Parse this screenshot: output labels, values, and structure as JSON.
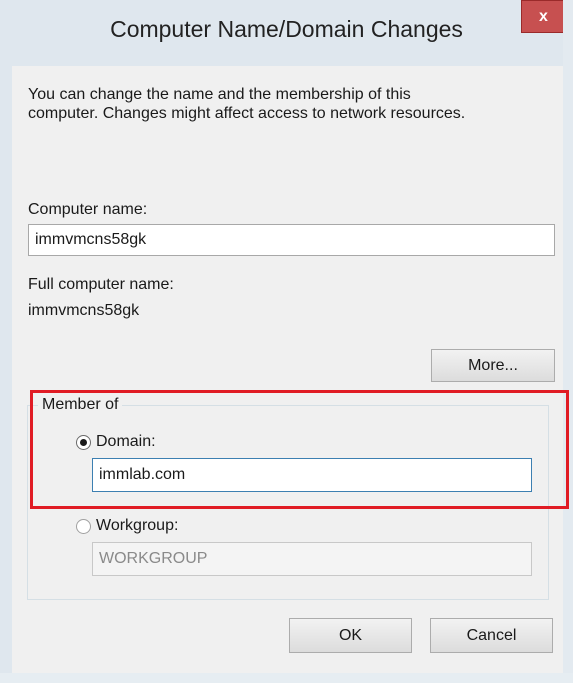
{
  "window": {
    "title": "Computer Name/Domain Changes",
    "close_label": "x"
  },
  "description": {
    "line1": "You can change the name and the membership of this",
    "line2": "computer. Changes might affect access to network resources."
  },
  "computer_name": {
    "label": "Computer name:",
    "value": "immvmcns58gk"
  },
  "full_name": {
    "label": "Full computer name:",
    "value": "immvmcns58gk"
  },
  "more_button": "More...",
  "member_of": {
    "label": "Member of",
    "domain": {
      "label": "Domain:",
      "selected": true,
      "value": "immlab.com"
    },
    "workgroup": {
      "label": "Workgroup:",
      "selected": false,
      "value": "WORKGROUP"
    }
  },
  "buttons": {
    "ok": "OK",
    "cancel": "Cancel"
  },
  "colors": {
    "highlight": "#e01b24",
    "close": "#c75050",
    "frame": "#dfe7ee"
  }
}
